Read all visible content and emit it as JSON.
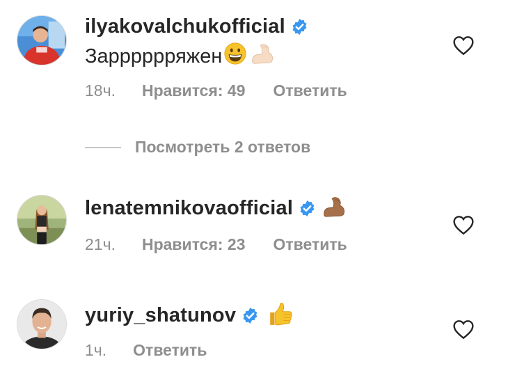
{
  "comments": [
    {
      "username": "ilyakovalchukofficial",
      "verified": true,
      "text": "Зарррррряжен",
      "text_emojis": [
        "grinning-face-emoji",
        "flexed-biceps-emoji"
      ],
      "time": "18ч.",
      "likes_label": "Нравится: 49",
      "reply_label": "Ответить",
      "avatar": "avatar-man-red-sweater"
    },
    {
      "username": "lenatemnikovaofficial",
      "verified": true,
      "text": "",
      "text_emojis": [
        "flexed-biceps-emoji"
      ],
      "time": "21ч.",
      "likes_label": "Нравится: 23",
      "reply_label": "Ответить",
      "avatar": "avatar-woman-outdoors"
    },
    {
      "username": "yuriy_shatunov",
      "verified": true,
      "text": "",
      "text_emojis": [
        "thumbs-up-emoji"
      ],
      "time": "1ч.",
      "likes_label": "",
      "reply_label": "Ответить",
      "avatar": "avatar-man-portrait"
    }
  ],
  "view_replies_label": "Посмотреть 2 ответов",
  "icons": {
    "like": "heart-outline-icon",
    "verified": "verified-badge-icon"
  },
  "colors": {
    "text": "#262626",
    "secondary": "#8e8e8e",
    "verified": "#3897f0",
    "border": "#dbdbdb"
  }
}
